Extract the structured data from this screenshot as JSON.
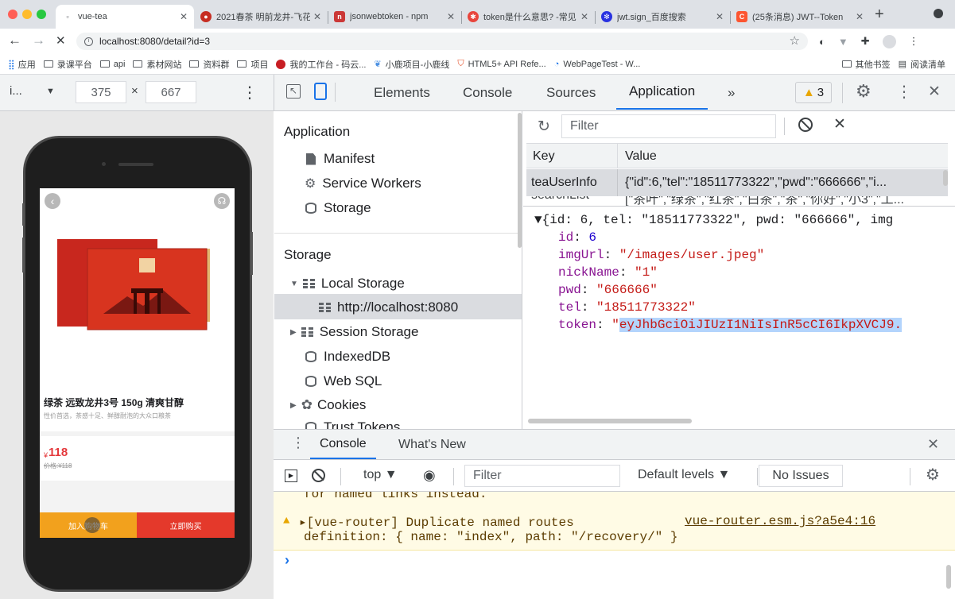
{
  "browser": {
    "tabs": [
      {
        "title": "vue-tea",
        "icon": "blank-page-icon",
        "active": true
      },
      {
        "title": "2021春茶 明前龙井-飞花",
        "icon": "tea-site-icon"
      },
      {
        "title": "jsonwebtoken - npm",
        "icon": "npm-icon"
      },
      {
        "title": "token是什么意思? -常见",
        "icon": "search-result-icon"
      },
      {
        "title": "jwt.sign_百度搜索",
        "icon": "baidu-icon"
      },
      {
        "title": "(25条消息) JWT--Token",
        "icon": "csdn-icon"
      }
    ],
    "new_tab": "+",
    "url": "localhost:8080/detail?id=3",
    "bookmarks": [
      "应用",
      "录课平台",
      "api",
      "素材网站",
      "资料群",
      "项目",
      "我的工作台 - 码云...",
      "小鹿项目-小鹿线",
      "HTML5+ API Refe...",
      "WebPageTest - W..."
    ],
    "bookmarks_right": [
      "其他书签",
      "阅读清单"
    ]
  },
  "device_toolbar": {
    "device": "i...",
    "width": "375",
    "times": "×",
    "height": "667"
  },
  "devtools": {
    "tabs": [
      "Elements",
      "Console",
      "Sources",
      "Application"
    ],
    "more": "»",
    "warnings": "3",
    "active_tab": "Application"
  },
  "sidebar": {
    "application_title": "Application",
    "application_items": [
      "Manifest",
      "Service Workers",
      "Storage"
    ],
    "storage_title": "Storage",
    "local_storage": "Local Storage",
    "local_origin": "http://localhost:8080",
    "session_storage": "Session Storage",
    "indexeddb": "IndexedDB",
    "websql": "Web SQL",
    "cookies": "Cookies",
    "trust_tokens": "Trust Tokens"
  },
  "storage": {
    "filter_placeholder": "Filter",
    "col_key": "Key",
    "col_value": "Value",
    "rows": [
      {
        "key": "teaUserInfo",
        "value": "{\"id\":6,\"tel\":\"18511773322\",\"pwd\":\"666666\",\"i..."
      },
      {
        "key": "searchList",
        "value": "[\"茶叶\",\"绿茶\",\"红茶\",\"白茶\",\"茶\",\"你好\",\"小3\",\"工..."
      }
    ],
    "preview_header": "▼{id: 6, tel: \"18511773322\", pwd: \"666666\", img",
    "preview": [
      {
        "key": "id",
        "value": "6",
        "type": "number"
      },
      {
        "key": "imgUrl",
        "value": "\"/images/user.jpeg\"",
        "type": "string"
      },
      {
        "key": "nickName",
        "value": "\"1\"",
        "type": "string"
      },
      {
        "key": "pwd",
        "value": "\"666666\"",
        "type": "string"
      },
      {
        "key": "tel",
        "value": "\"18511773322\"",
        "type": "string"
      }
    ],
    "token_key": "token",
    "token_quote": "\"",
    "token_value": "eyJhbGciOiJIUzI1NiIsInR5cCI6IkpXVCJ9."
  },
  "console": {
    "tabs": [
      "Console",
      "What's New"
    ],
    "context": "top ▼",
    "filter_placeholder": "Filter",
    "levels": "Default levels ▼",
    "issues": "No Issues",
    "line_cut": "for named links instead.",
    "warning_text": "▸[vue-router] Duplicate named routes",
    "warning_source": "vue-router.esm.js?a5e4:16",
    "warning_text2": "definition: { name: \"index\", path: \"/recovery/\" }",
    "prompt": "›"
  },
  "product": {
    "name": "绿茶 远致龙井3号 150g 清爽甘醇",
    "subtitle": "性价首选，茶感十足、鲜醇耐泡的大众口粮茶",
    "currency": "¥",
    "price": "118",
    "old_price": "价格:¥118",
    "add_cart": "加入购物车",
    "buy_now": "立即购买"
  },
  "colors": {
    "accent": "#1a73e8",
    "string": "#c41a16",
    "key": "#881391",
    "number": "#1c00cf",
    "price": "#e4393c",
    "cart": "#f2a11d",
    "buy": "#e4392b"
  }
}
